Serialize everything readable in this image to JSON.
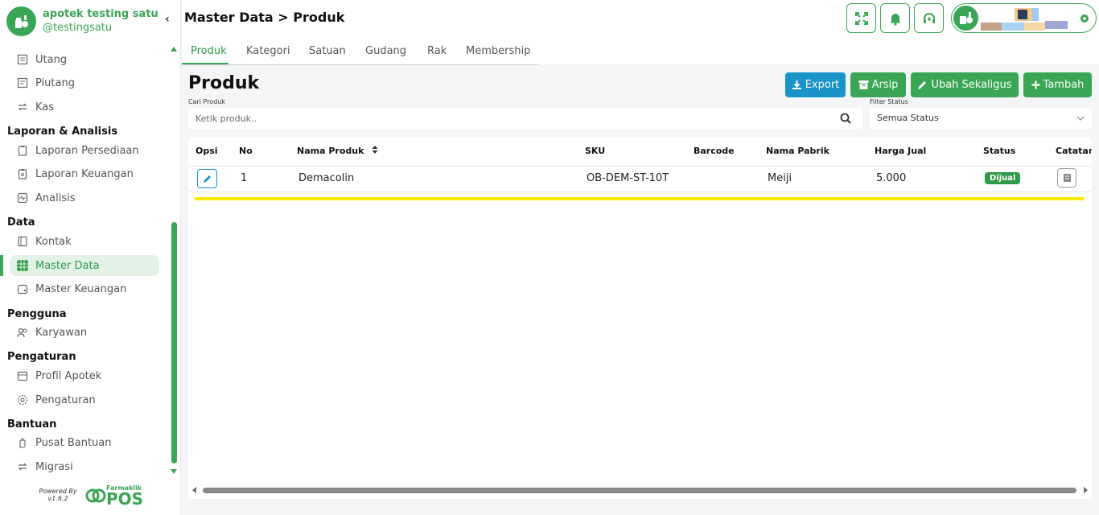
{
  "brand": {
    "name": "apotek testing satu",
    "handle": "@testingsatu"
  },
  "sidebar": {
    "items_finance": [
      {
        "label": "Utang",
        "icon": "receipt-icon"
      },
      {
        "label": "Piutang",
        "icon": "invoice-icon"
      },
      {
        "label": "Kas",
        "icon": "transfer-icon"
      }
    ],
    "section_report": "Laporan & Analisis",
    "items_report": [
      {
        "label": "Laporan Persediaan",
        "icon": "clipboard-icon"
      },
      {
        "label": "Laporan Keuangan",
        "icon": "clipboard-money-icon"
      },
      {
        "label": "Analisis",
        "icon": "pulse-icon"
      }
    ],
    "section_data": "Data",
    "items_data": [
      {
        "label": "Kontak",
        "icon": "contact-book-icon"
      },
      {
        "label": "Master Data",
        "icon": "database-icon"
      },
      {
        "label": "Master Keuangan",
        "icon": "wallet-icon"
      }
    ],
    "section_users": "Pengguna",
    "items_users": [
      {
        "label": "Karyawan",
        "icon": "users-icon"
      }
    ],
    "section_settings": "Pengaturan",
    "items_settings": [
      {
        "label": "Profil Apotek",
        "icon": "store-icon"
      },
      {
        "label": "Pengaturan",
        "icon": "gear-icon"
      }
    ],
    "section_help": "Bantuan",
    "items_help": [
      {
        "label": "Pusat Bantuan",
        "icon": "hand-icon"
      },
      {
        "label": "Migrasi",
        "icon": "transfer-icon"
      }
    ],
    "powered_by": "Powered By",
    "version": "v1.6.2",
    "logo_small": "Farmaklik",
    "logo_big": "POS"
  },
  "header": {
    "title": "Master Data > Produk"
  },
  "tabs": [
    {
      "label": "Produk"
    },
    {
      "label": "Kategori"
    },
    {
      "label": "Satuan"
    },
    {
      "label": "Gudang"
    },
    {
      "label": "Rak"
    },
    {
      "label": "Membership"
    }
  ],
  "content": {
    "title": "Produk",
    "buttons": {
      "export": "Export",
      "archive": "Arsip",
      "bulk_edit": "Ubah Sekaligus",
      "add": "Tambah"
    },
    "search_label": "Cari Produk",
    "search_placeholder": "Ketik produk..",
    "filter_label": "Filter Status",
    "filter_value": "Semua Status"
  },
  "table": {
    "columns": [
      "Opsi",
      "No",
      "Nama Produk",
      "SKU",
      "Barcode",
      "Nama Pabrik",
      "Harga Jual",
      "Status",
      "Catatan"
    ],
    "rows": [
      {
        "no": "1",
        "name": "Demacolin",
        "sku": "OB-DEM-ST-10T",
        "barcode": "",
        "factory": "Meiji",
        "price": "5.000",
        "status": "Dijual"
      }
    ]
  },
  "colors": {
    "accent": "#3aa655",
    "blue": "#1a93c9",
    "highlight": "#ffe800"
  }
}
